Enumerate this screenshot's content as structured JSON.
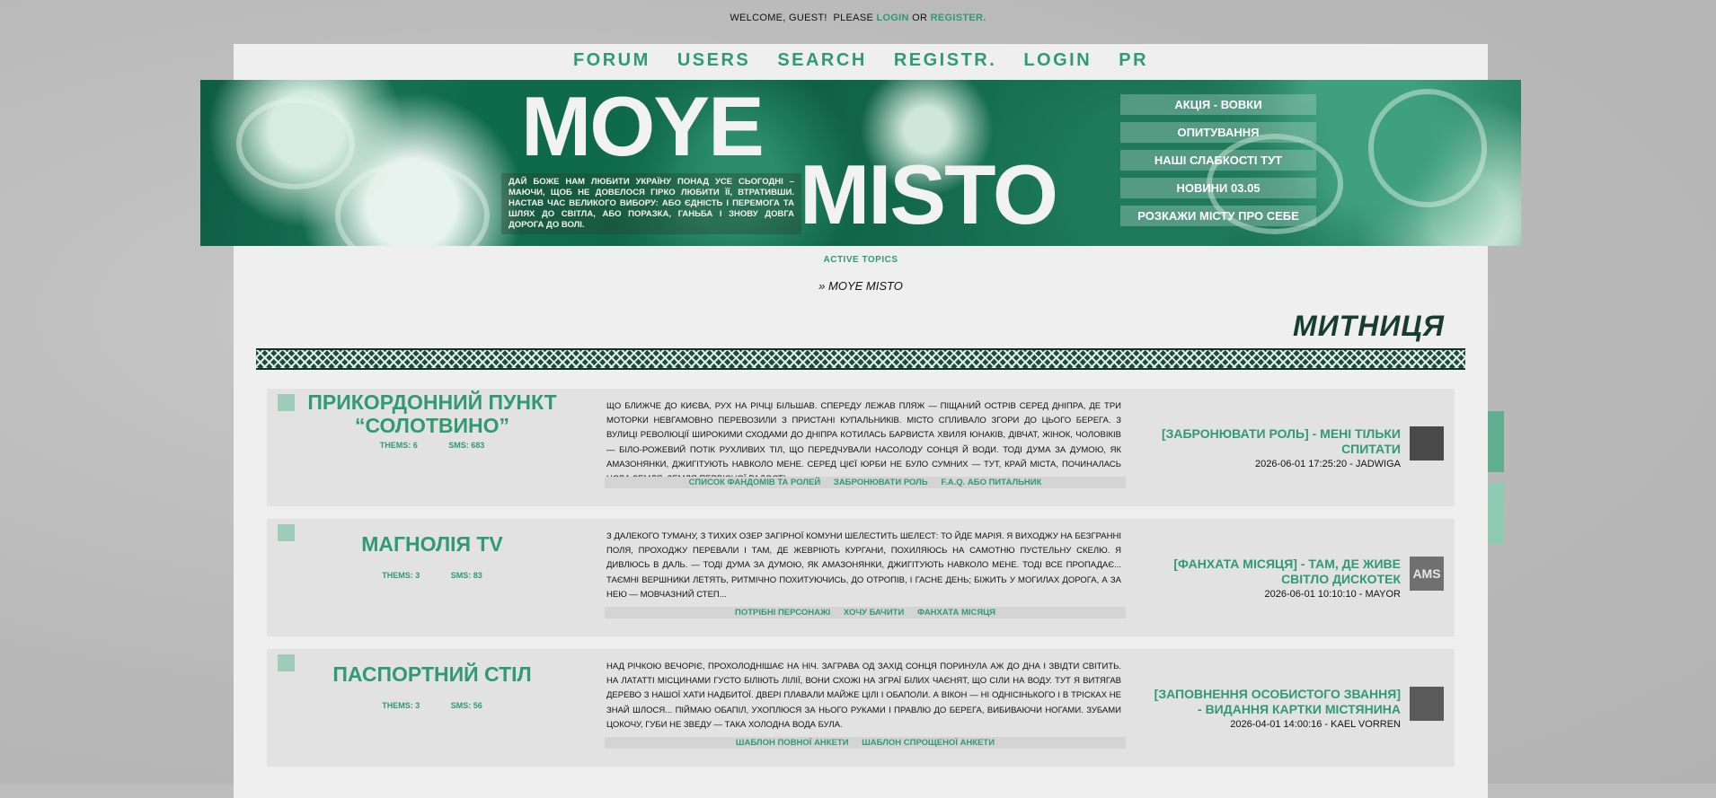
{
  "welcome": {
    "text": "WELCOME, GUEST!",
    "please": "PLEASE",
    "login": "LOGIN",
    "or": "OR",
    "register": "REGISTER."
  },
  "topnav": [
    "FORUM",
    "USERS",
    "SEARCH",
    "REGISTR.",
    "LOGIN",
    "PR"
  ],
  "banner": {
    "logo_line1": "MOYE",
    "logo_line2": "MISTO",
    "motto": "ДАЙ БОЖЕ НАМ ЛЮБИТИ УКРАЇНУ ПОНАД УСЕ СЬОГОДНІ – МАЮЧИ, ЩОБ НЕ ДОВЕЛОСЯ ГІРКО ЛЮБИТИ ЇЇ, ВТРАТИВШИ. НАСТАВ ЧАС ВЕЛИКОГО ВИБОРУ: АБО ЄДНІСТЬ І ПЕРЕМОГА ТА ШЛЯХ ДО СВІТЛА, АБО ПОРАЗКА, ГАНЬБА І ЗНОВУ ДОВГА ДОРОГА ДО ВОЛІ.",
    "menu": [
      "АКЦІЯ - ВОВКИ",
      "ОПИТУВАННЯ",
      "НАШІ СЛАБКОСТІ ТУТ",
      "НОВИНИ 03.05",
      "РОЗКАЖИ МІСТУ ПРО СЕБЕ"
    ]
  },
  "active_topics": "ACTIVE TOPICS",
  "breadcrumb": "» MOYE MISTO",
  "section_title": "МИТНИЦЯ",
  "forums": [
    {
      "name": "ПРИКОРДОННИЙ ПУНКТ “СОЛОТВИНО”",
      "themes": "THEMS: 6",
      "sms": "SMS: 683",
      "description": "ЩО БЛИЖЧЕ ДО КИЄВА, РУХ НА РІЧЦІ БІЛЬШАВ. СПЕРЕДУ ЛЕЖАВ ПЛЯЖ — ПІЩАНИЙ ОСТРІВ СЕРЕД ДНІПРА, ДЕ ТРИ МОТОРКИ НЕВГАМОВНО ПЕРЕВОЗИЛИ З ПРИСТАНІ КУПАЛЬНИКІВ. МІСТО СПЛИВАЛО ЗГОРИ ДО ЦЬОГО БЕРЕГА. З ВУЛИЦІ РЕВОЛЮЦІЇ ШИРОКИМИ СХОДАМИ ДО ДНІПРА КОТИЛАСЬ БАРВИСТА ХВИЛЯ ЮНАКІВ, ДІВЧАТ, ЖІНОК, ЧОЛОВІКІВ — БІЛО-РОЖЕВИЙ ПОТІК РУХЛИВИХ ТІЛ, ЩО ПЕРЕДЧУВАЛИ НАСОЛОДУ СОНЦЯ Й ВОДИ. ТОДІ ДУМА ЗА ДУМОЮ, ЯК АМАЗОНЯНКИ, ДЖИГІТУЮТЬ НАВКОЛО МЕНЕ. СЕРЕД ЦІЄЇ ЮРБИ НЕ БУЛО СУМНИХ — ТУТ, КРАЙ МІСТА, ПОЧИНАЛАСЬ НОВА ЗЕМЛЯ, ЗЕМЛЯ ПЕРВІСНОЇ РАДОСТІ.",
      "links": [
        "СПИСОК ФАНДОМІВ ТА РОЛЕЙ",
        "ЗАБРОНЮВАТИ РОЛЬ",
        "F.A.Q. АБО ПИТАЛЬНИК"
      ],
      "last_title": "[ЗАБРОНЮВАТИ РОЛЬ] - МЕНІ ТІЛЬКИ СПИТАТИ",
      "last_meta": "2026-06-01 17:25:20 - JADWIGA",
      "avatar_text": ""
    },
    {
      "name": "МАГНОЛІЯ TV",
      "themes": "THEMS: 3",
      "sms": "SMS: 83",
      "description": "З ДАЛЕКОГО ТУМАНУ, З ТИХИХ ОЗЕР ЗАГІРНОЇ КОМУНИ ШЕЛЕСТИТЬ ШЕЛЕСТ: ТО ЙДЕ МАРІЯ. Я ВИХОДЖУ НА БЕЗГРАННІ ПОЛЯ, ПРОХОДЖУ ПЕРЕВАЛИ І ТАМ, ДЕ ЖЕВРІЮТЬ КУРГАНИ, ПОХИЛЯЮСЬ НА САМОТНЮ ПУСТЕЛЬНУ СКЕЛЮ. Я ДИВЛЮСЬ В ДАЛЬ. — ТОДІ ДУМА ЗА ДУМОЮ, ЯК АМАЗОНЯНКИ, ДЖИГІТУЮТЬ НАВКОЛО МЕНЕ. ТОДІ ВСЕ ПРОПАДАЄ... ТАЄМНІ ВЕРШНИКИ ЛЕТЯТЬ, РИТМІЧНО ПОХИТУЮЧИСЬ, ДО ОТРОПІВ, І ГАСНЕ ДЕНЬ; БІЖИТЬ У МОГИЛАХ ДОРОГА, А ЗА НЕЮ — МОВЧАЗНИЙ СТЕП...",
      "links": [
        "ПОТРІБНІ ПЕРСОНАЖІ",
        "ХОЧУ БАЧИТИ",
        "ФАНХАТА МІСЯЦЯ"
      ],
      "last_title": "[ФАНХАТА МІСЯЦЯ] - ТАМ, ДЕ ЖИВЕ СВІТЛО ДИСКОТЕК",
      "last_meta": "2026-06-01 10:10:10 - MAYOR",
      "avatar_text": "AMS"
    },
    {
      "name": "ПАСПОРТНИЙ СТІЛ",
      "themes": "THEMS: 3",
      "sms": "SMS: 56",
      "description": "НАД РІЧКОЮ ВЕЧОРІЄ, ПРОХОЛОДНІШАЄ НА НІЧ. ЗАГРАВА ОД ЗАХІД СОНЦЯ ПОРИНУЛА АЖ ДО ДНА І ЗВІДТИ СВІТИТЬ. НА ЛАТАТТІ МІСЦИНАМИ ГУСТО БІЛІЮТЬ ЛІЛІЇ, ВОНИ СХОЖІ НА ЗГРАЇ БІЛИХ ЧАЄНЯТ, ЩО СІЛИ НА ВОДУ. ТУТ Я ВИТЯГАВ ДЕРЕВО З НАШОЇ ХАТИ НАДБИТОЇ. ДВЕРІ ПЛАВАЛИ МАЙЖЕ ЦІЛІ І ОБАПОЛИ. А ВІКОН — НІ ОДНІСІНЬКОГО І В ТРІСКАХ НЕ ЗНАЙ ШЛОСЯ... ПІЙМАЮ ОБАПІЛ, УХОПЛЮСЯ ЗА НЬОГО РУКАМИ І ПРАВЛЮ ДО БЕРЕГА, ВИБИВАЮЧИ НОГАМИ. ЗУБАМИ ЦОКОЧУ, ГУБИ НЕ ЗВЕДУ — ТАКА ХОЛОДНА ВОДА БУЛА.",
      "links": [
        "ШАБЛОН ПОВНОЇ АНКЕТИ",
        "ШАБЛОН СПРОЩЕНОЇ АНКЕТИ"
      ],
      "last_title": "[ЗАПОВНЕННЯ ОСОБИСТОГО ЗВАННЯ] - ВИДАННЯ КАРТКИ МІСТЯНИНА",
      "last_meta": "2026-04-01 14:00:16 - KAEL VORREN",
      "avatar_text": ""
    }
  ],
  "colors": {
    "accent": "#2f9a74",
    "page_bg": "#efefef",
    "row_bg": "#e2e2e2",
    "title_dark": "#173d31"
  }
}
